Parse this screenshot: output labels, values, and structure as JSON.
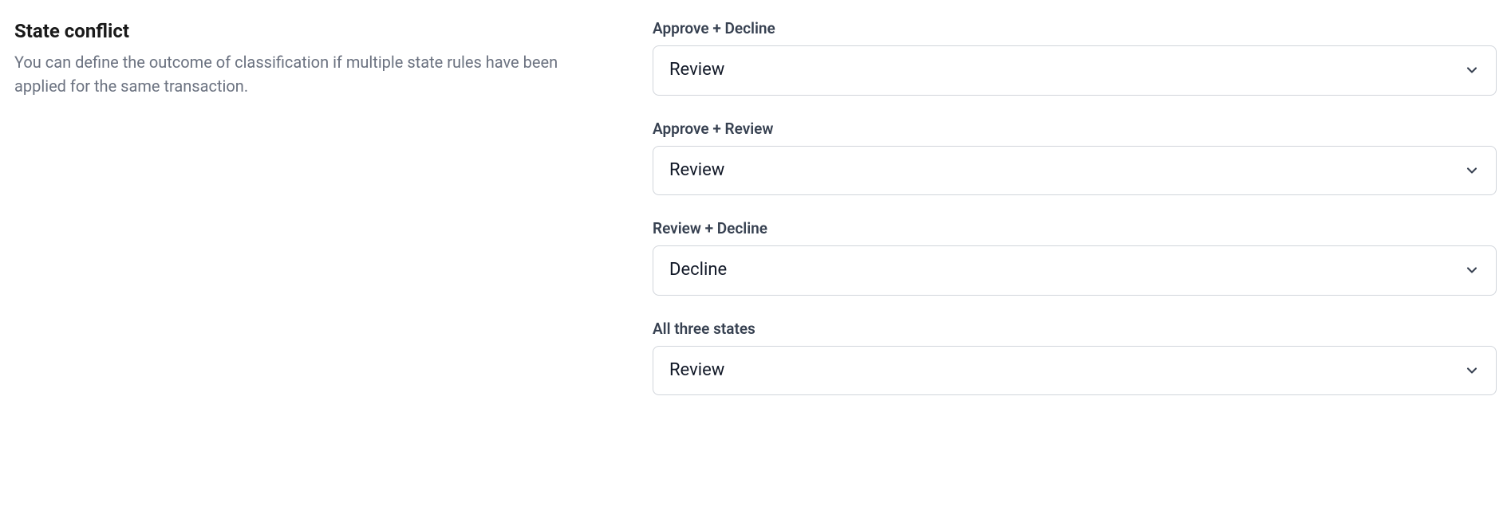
{
  "section": {
    "title": "State conflict",
    "description": "You can define the outcome of classification if multiple state rules have been applied for the same transaction."
  },
  "fields": [
    {
      "label": "Approve + Decline",
      "value": "Review"
    },
    {
      "label": "Approve + Review",
      "value": "Review"
    },
    {
      "label": "Review + Decline",
      "value": "Decline"
    },
    {
      "label": "All three states",
      "value": "Review"
    }
  ]
}
